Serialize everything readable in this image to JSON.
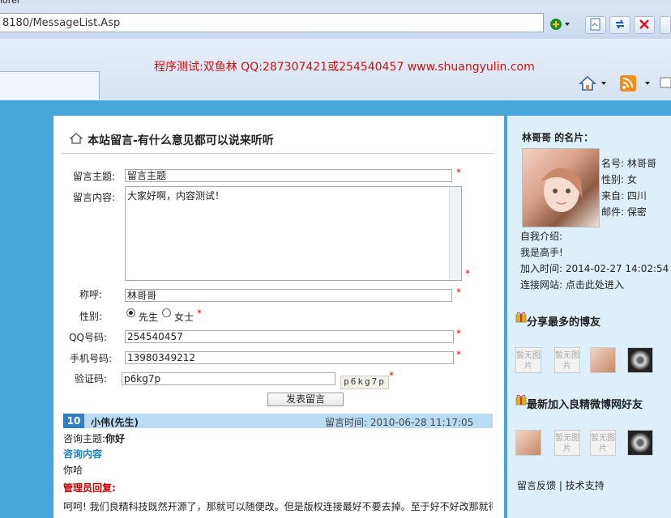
{
  "browser": {
    "title_fragment": "lorer",
    "url": "8180/MessageList.Asp",
    "notice": "程序测试:双鱼林 QQ:287307421或254540457 www.shuangyulin.com"
  },
  "form": {
    "heading": "本站留言-有什么意见都可以说来听听",
    "subject_label": "留言主题:",
    "subject_value": "留言主题",
    "content_label": "留言内容:",
    "content_value": "大家好啊，内容测试！",
    "name_label": "称呼:",
    "name_value": "林哥哥",
    "gender_label": "性别:",
    "gender_male": "先生",
    "gender_female": "女士",
    "qq_label": "QQ号码:",
    "qq_value": "254540457",
    "phone_label": "手机号码:",
    "phone_value": "13980349212",
    "captcha_label": "验证码:",
    "captcha_value": "p6kg7p",
    "captcha_image_text": "p6kg7p",
    "required_mark": "*",
    "submit_label": "发表留言"
  },
  "message": {
    "number": "10",
    "author": "小伟(先生)",
    "time": "留言时间: 2010-06-28 11:17:05",
    "subject_label": "咨询主题:",
    "subject_value": "你好",
    "content_heading": "咨询内容",
    "content_value": "你哈",
    "reply_heading": "管理员回复:",
    "reply_text": "呵呵! 我们良精科技既然开源了，那就可以随便改。但是版权连接最好不要去掉。至于好不好改那就得看"
  },
  "sidebar": {
    "card_title": "林哥哥 的名片：",
    "name": "名号: 林哥哥",
    "gender": "性别: 女",
    "from": "来自: 四川",
    "email": "邮件: 保密",
    "intro_label": "自我介绍:",
    "intro_value": "我是高手!",
    "joined": "加入时间: 2014-02-27 14:02:54",
    "site": "连接网站: 点击此处进入",
    "share_title": "分享最多的博友",
    "new_title": "最新加入良精微博网好友",
    "no_image": "暂无图片",
    "links": "留言反馈 | 技术支持"
  },
  "colors": {
    "page_bg": "#48a7da",
    "sidebar_bg": "#dceffb",
    "message_bar": "#b9dcf4",
    "message_number_bg": "#2f7fc2",
    "required": "#ee0000",
    "notice": "#cc1111",
    "admin_reply": "#cc0000",
    "content_heading": "#1a7fc1"
  },
  "icons": [
    "home-icon",
    "rss-icon",
    "compat-icon",
    "refresh-icon",
    "stop-icon",
    "gift-icon"
  ]
}
